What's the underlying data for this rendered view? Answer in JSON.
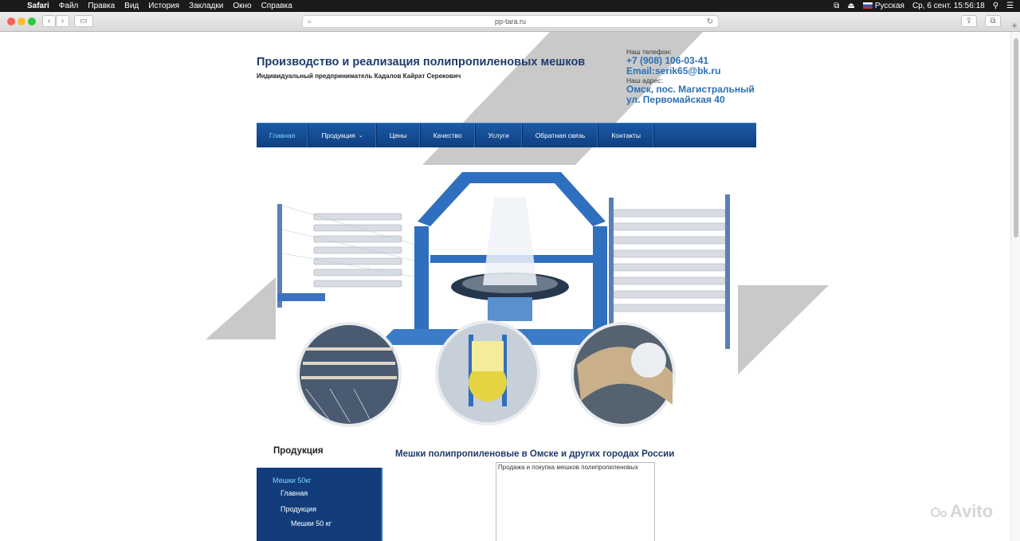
{
  "menubar": {
    "app": "Safari",
    "menus": [
      "Файл",
      "Правка",
      "Вид",
      "История",
      "Закладки",
      "Окно",
      "Справка"
    ],
    "input_lang": "Русская",
    "datetime": "Ср, 6 сент.  15:56:18"
  },
  "browser": {
    "url": "pp-tara.ru"
  },
  "site": {
    "title": "Производство и реализация полипропиленовых мешков",
    "subtitle": "Индивидуальный предприниматель Кадалов Кайрат Серекович",
    "phone_label": "Наш телефон:",
    "phone": "+7 (908) 106-03-41",
    "email": "Email:serik65@bk.ru",
    "address_label": "Наш адрес:",
    "address_line1": "Омск, пос. Магистральный",
    "address_line2": "ул. Первомайская 40"
  },
  "nav": {
    "items": [
      "Главная",
      "Продукция",
      "Цены",
      "Качество",
      "Услуги",
      "Обратная связь",
      "Контакты"
    ],
    "active": "Главная"
  },
  "sidebar": {
    "title": "Продукция",
    "active_item": "Мешки 50кг",
    "items": [
      "Главная",
      "Продукция",
      "Мешки 50 кг"
    ]
  },
  "main": {
    "heading": "Мешки полипропиленовые в Омске и других городах России",
    "box_text": "Продажа и покупка мешков полипропиленовых"
  },
  "watermark": "Avito",
  "colors": {
    "brand_blue": "#1e3a6b",
    "nav_blue": "#1b5aa6",
    "link_blue": "#2b6fb6",
    "active_cyan": "#7fd7ff",
    "machine_blue": "#2f6fbf"
  }
}
